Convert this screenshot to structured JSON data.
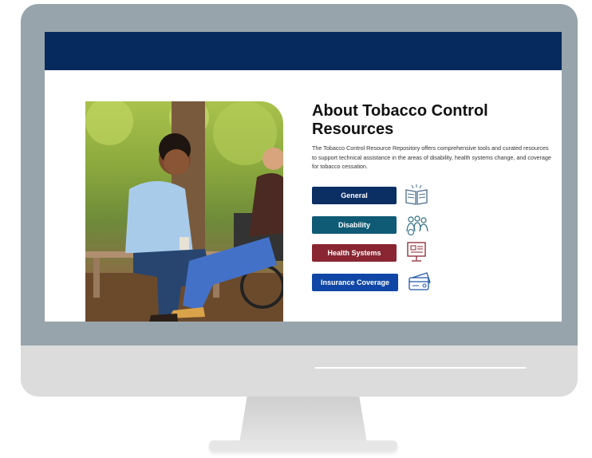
{
  "page": {
    "title": "About Tobacco Control Resources",
    "description": "The Tobacco Control Resource Repository offers comprehensive tools and curated resources to support technical assistance in the areas of disability, health systems change, and coverage for tobacco cessation."
  },
  "buttons": [
    {
      "label": "General",
      "icon": "open-book-icon"
    },
    {
      "label": "Disability",
      "icon": "people-group-icon"
    },
    {
      "label": "Health Systems",
      "icon": "computer-monitor-icon"
    },
    {
      "label": "Insurance Coverage",
      "icon": "insurance-card-icon"
    }
  ],
  "colors": {
    "header": "#062a5e",
    "general": "#0b2e63",
    "disability": "#0f5a74",
    "health_systems": "#8a2631",
    "insurance_coverage": "#1047a6",
    "frame": "#98a4ab"
  }
}
